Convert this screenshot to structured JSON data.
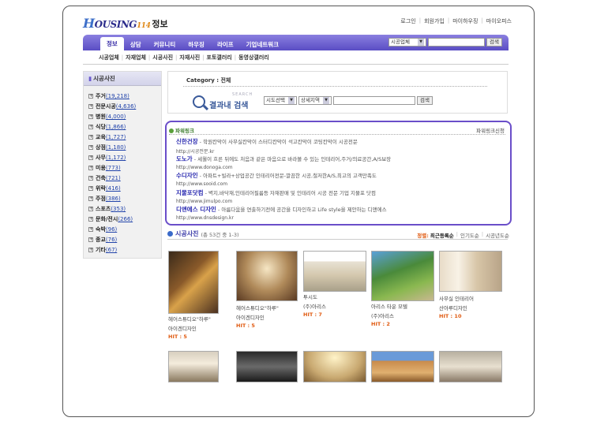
{
  "header": {
    "logo": {
      "h": "H",
      "rest": "OUSING",
      "num": "114",
      "text": "정보"
    },
    "toplinks": [
      "로그인",
      "회원가입",
      "마이하우징",
      "마이오피스"
    ]
  },
  "nav": {
    "tabs": [
      "정보",
      "상담",
      "커뮤니티",
      "하우징",
      "라이프",
      "기업네트워크"
    ],
    "active_index": 0,
    "search": {
      "select": "시공업체",
      "button": "검색"
    }
  },
  "subnav": [
    "시공업체",
    "자재업체",
    "시공사진",
    "자재사진",
    "포토갤러리",
    "동영상갤러리"
  ],
  "sidebar": {
    "title": "시공사진",
    "items": [
      {
        "label": "주거",
        "count": "(19,218)"
      },
      {
        "label": "전문시공",
        "count": "(4,636)"
      },
      {
        "label": "병원",
        "count": "(4,000)"
      },
      {
        "label": "식당",
        "count": "(1,866)"
      },
      {
        "label": "교육",
        "count": "(1,727)"
      },
      {
        "label": "상점",
        "count": "(1,180)"
      },
      {
        "label": "사무",
        "count": "(1,172)"
      },
      {
        "label": "미용",
        "count": "(773)"
      },
      {
        "label": "건축",
        "count": "(721)"
      },
      {
        "label": "위락",
        "count": "(416)"
      },
      {
        "label": "주점",
        "count": "(386)"
      },
      {
        "label": "스포츠",
        "count": "(353)"
      },
      {
        "label": "문화/전시",
        "count": "(266)"
      },
      {
        "label": "숙박",
        "count": "(96)"
      },
      {
        "label": "종교",
        "count": "(76)"
      },
      {
        "label": "기타",
        "count": "(67)"
      }
    ]
  },
  "category": {
    "label": "Category : 전체",
    "search_eng": "SEARCH",
    "search_kor": "결과내 검색",
    "select1": "시도선택",
    "select2": "상세지역",
    "button": "검색"
  },
  "power": {
    "title": "파워링크",
    "apply": "파워링크신청",
    "ads": [
      {
        "name": "신한건장",
        "desc": " - 학원칸막이 사무실칸막이 스터디칸막이 석고칸막이 코팅칸막이 시공전문",
        "url": "http://시공전문.kr"
      },
      {
        "name": "도노가",
        "desc": " - 세월이 흐른 뒤에도 처음과 같은 마음으로 바라볼 수 있는 인테리어,주거/의료공간,A/S보장",
        "url": "http://www.donoga.com"
      },
      {
        "name": "수디자인",
        "desc": " - 아파트+빌라+상업공간 인테리어전문-깔끔한 시공,철저한A/S,최고의 고객만족도",
        "url": "http://www.sooid.com"
      },
      {
        "name": "지물포닷컴",
        "desc": " - 벽지,바닥재,인테리어필름등 자재판매 및 인테리어 시공 전문 기업 지물포 닷컴",
        "url": "http://www.jimulpo.com"
      },
      {
        "name": "디앤에스 디자인",
        "desc": " - 아름다움을 연출하기전에 공간을 디자인하고 Life style을 제안하는 디앤에스",
        "url": "http://www.dnsdesign.kr"
      }
    ]
  },
  "photos": {
    "title": "시공사진",
    "count_text": "(총 53건 중 1-3)",
    "sort_label": "정렬:",
    "sort_options": [
      "최근등록순",
      "인기도순",
      "시공년도순"
    ],
    "sort_active": 0,
    "items": [
      {
        "line1": "헤어스튜디오\"하루\"",
        "line2": "아이겐디자인",
        "hit": "HIT : 5"
      },
      {
        "line1": "헤어스튜디오\"하루\"",
        "line2": "아이겐디자인",
        "hit": "HIT : 5"
      },
      {
        "line1": "투시도",
        "line2": "(주)아리스",
        "hit": "HIT : 7"
      },
      {
        "line1": "아리스 타운 모텔",
        "line2": "(주)아리스",
        "hit": "HIT : 2"
      },
      {
        "line1": "사무실 인테리어",
        "line2": "산아루디자인",
        "hit": "HIT : 10"
      }
    ]
  },
  "colors": {
    "nav": "#5a4dc4",
    "power_border": "#6a4ec9",
    "hit": "#e05a10",
    "link": "#2a2ab0"
  }
}
